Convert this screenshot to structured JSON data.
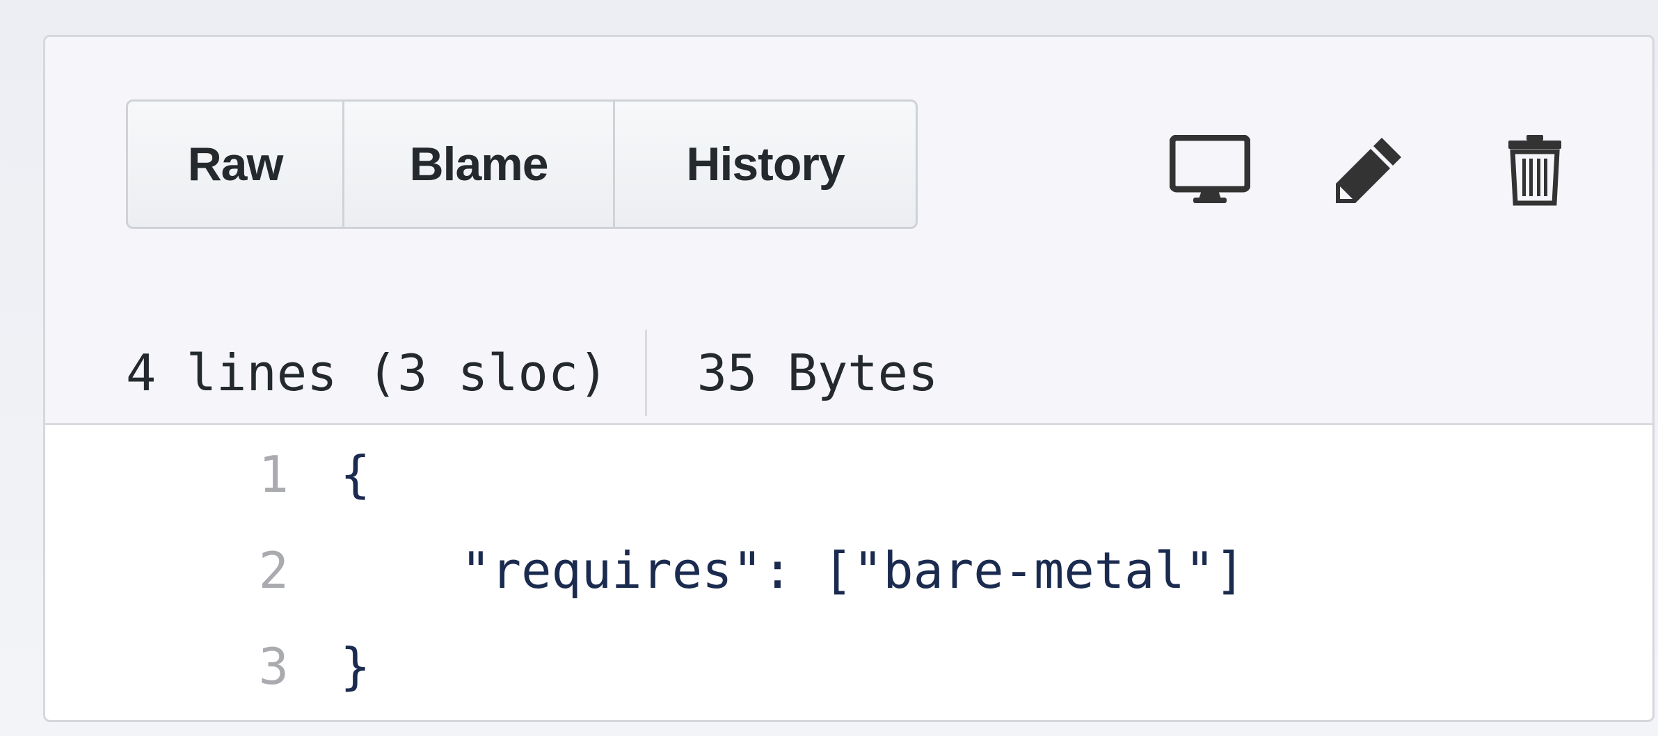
{
  "toolbar": {
    "buttons": [
      {
        "label": "Raw"
      },
      {
        "label": "Blame"
      },
      {
        "label": "History"
      }
    ],
    "icons": [
      {
        "name": "desktop-icon"
      },
      {
        "name": "pencil-icon"
      },
      {
        "name": "trash-icon"
      }
    ]
  },
  "file_info": {
    "lines": "4 lines (3 sloc)",
    "size": "35 Bytes"
  },
  "code": {
    "lines": [
      {
        "number": "1",
        "text": "{"
      },
      {
        "number": "2",
        "text": "    \"requires\": [\"bare-metal\"]"
      },
      {
        "number": "3",
        "text": "}"
      }
    ]
  },
  "colors": {
    "header_bg": "#f5f5fa",
    "border": "#d5d7dc",
    "code_text": "#1b2b4f",
    "line_number": "#a9abae",
    "icon": "#333333"
  }
}
